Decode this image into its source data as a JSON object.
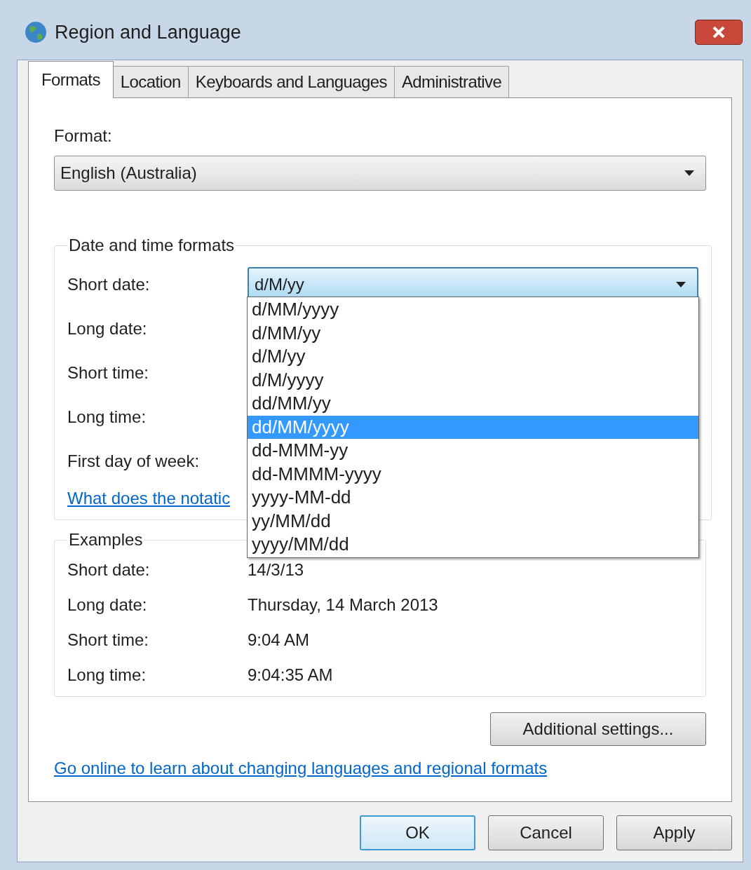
{
  "window": {
    "title": "Region and Language"
  },
  "tabs": [
    {
      "label": "Formats",
      "selected": true
    },
    {
      "label": "Location",
      "selected": false
    },
    {
      "label": "Keyboards and Languages",
      "selected": false
    },
    {
      "label": "Administrative",
      "selected": false
    }
  ],
  "format": {
    "label": "Format:",
    "value": "English (Australia)"
  },
  "date_time_formats": {
    "title": "Date and time formats",
    "rows": [
      {
        "label": "Short date:"
      },
      {
        "label": "Long date:"
      },
      {
        "label": "Short time:"
      },
      {
        "label": "Long time:"
      },
      {
        "label": "First day of week:"
      }
    ],
    "short_date_value": "d/M/yy",
    "options": [
      {
        "label": "d/MM/yyyy",
        "selected": false
      },
      {
        "label": "d/MM/yy",
        "selected": false
      },
      {
        "label": "d/M/yy",
        "selected": false
      },
      {
        "label": "d/M/yyyy",
        "selected": false
      },
      {
        "label": "dd/MM/yy",
        "selected": false
      },
      {
        "label": "dd/MM/yyyy",
        "selected": true
      },
      {
        "label": "dd-MMM-yy",
        "selected": false
      },
      {
        "label": "dd-MMMM-yyyy",
        "selected": false
      },
      {
        "label": "yyyy-MM-dd",
        "selected": false
      },
      {
        "label": "yy/MM/dd",
        "selected": false
      },
      {
        "label": "yyyy/MM/dd",
        "selected": false
      }
    ],
    "link": "What does the notatic"
  },
  "examples": {
    "title": "Examples",
    "rows": [
      {
        "label": "Short date:",
        "value": "14/3/13"
      },
      {
        "label": "Long date:",
        "value": "Thursday, 14 March 2013"
      },
      {
        "label": "Short time:",
        "value": "9:04 AM"
      },
      {
        "label": "Long time:",
        "value": "9:04:35 AM"
      }
    ]
  },
  "additional_settings": "Additional settings...",
  "online_link": "Go online to learn about changing languages and regional formats",
  "buttons": [
    {
      "label": "OK",
      "default": true
    },
    {
      "label": "Cancel",
      "default": false
    },
    {
      "label": "Apply",
      "default": false
    }
  ]
}
